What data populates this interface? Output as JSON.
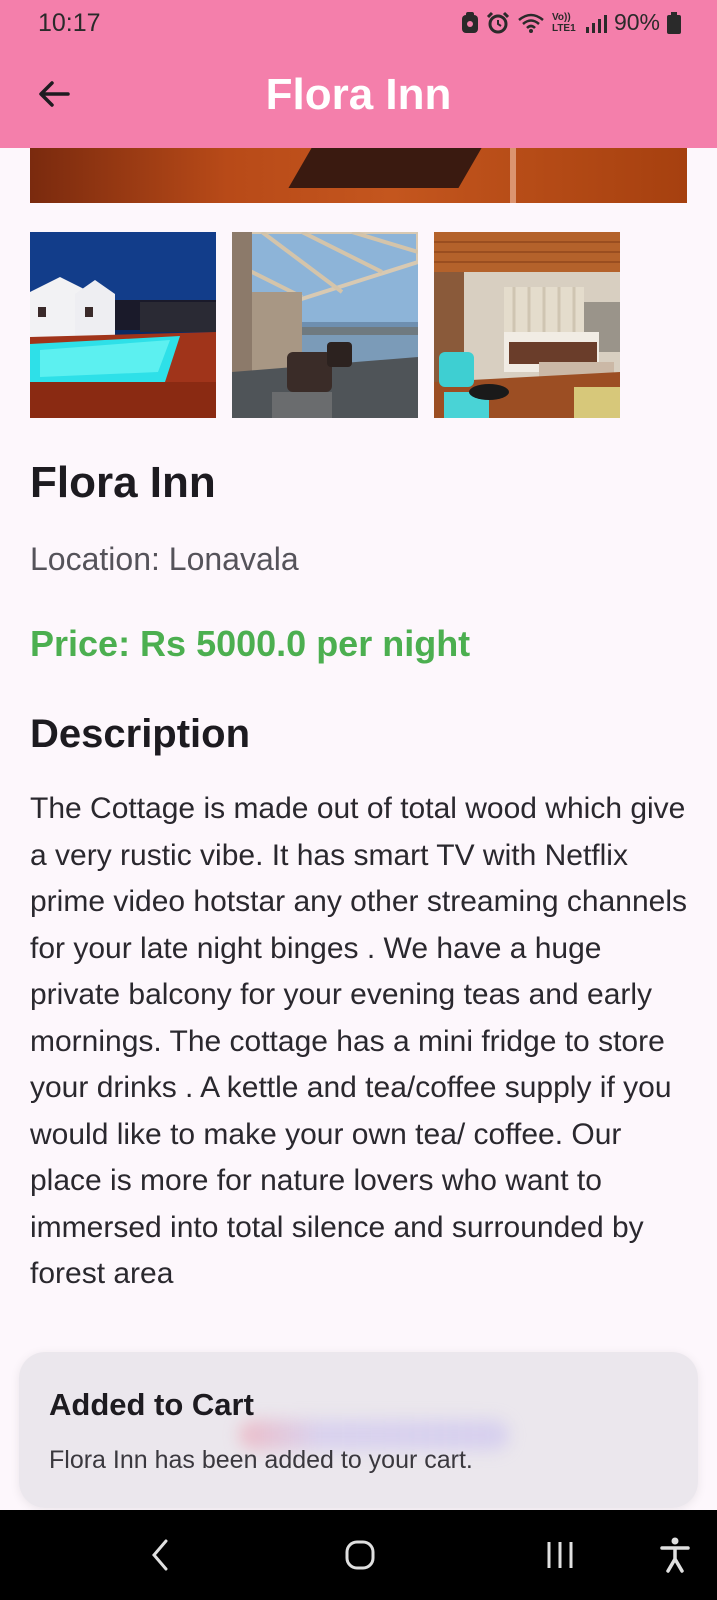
{
  "status_bar": {
    "time": "10:17",
    "network_label": "Vo)) LTE1",
    "battery": "90%"
  },
  "app_bar": {
    "title": "Flora Inn",
    "back_icon": "arrow-left-icon"
  },
  "gallery": {
    "hero": "hotel interior photo (cropped)",
    "thumbnails": [
      "pool-photo",
      "balcony-photo",
      "bedroom-photo"
    ]
  },
  "hotel": {
    "name": "Flora Inn",
    "location": "Location: Lonavala",
    "price": "Price: Rs 5000.0 per night",
    "description_heading": "Description",
    "description": "The Cottage is made out of total wood which give a very rustic vibe. It has smart TV with Netflix prime video hotstar any other streaming channels for your late night binges . We have a huge private balcony for your evening teas and early mornings. The cottage has a mini fridge to store your drinks . A kettle and tea/coffee supply if you would like to make your own tea/ coffee. Our place is more for nature lovers who want to immersed into total silence and surrounded by forest area"
  },
  "toast": {
    "title": "Added to Cart",
    "message": "Flora Inn has been added to your cart."
  },
  "nav_bar": {
    "buttons": [
      "back-icon",
      "home-icon",
      "recents-icon",
      "accessibility-icon"
    ]
  },
  "colors": {
    "app_bar": "#f47fab",
    "price": "#4caf50",
    "background": "#fdf7fc"
  }
}
